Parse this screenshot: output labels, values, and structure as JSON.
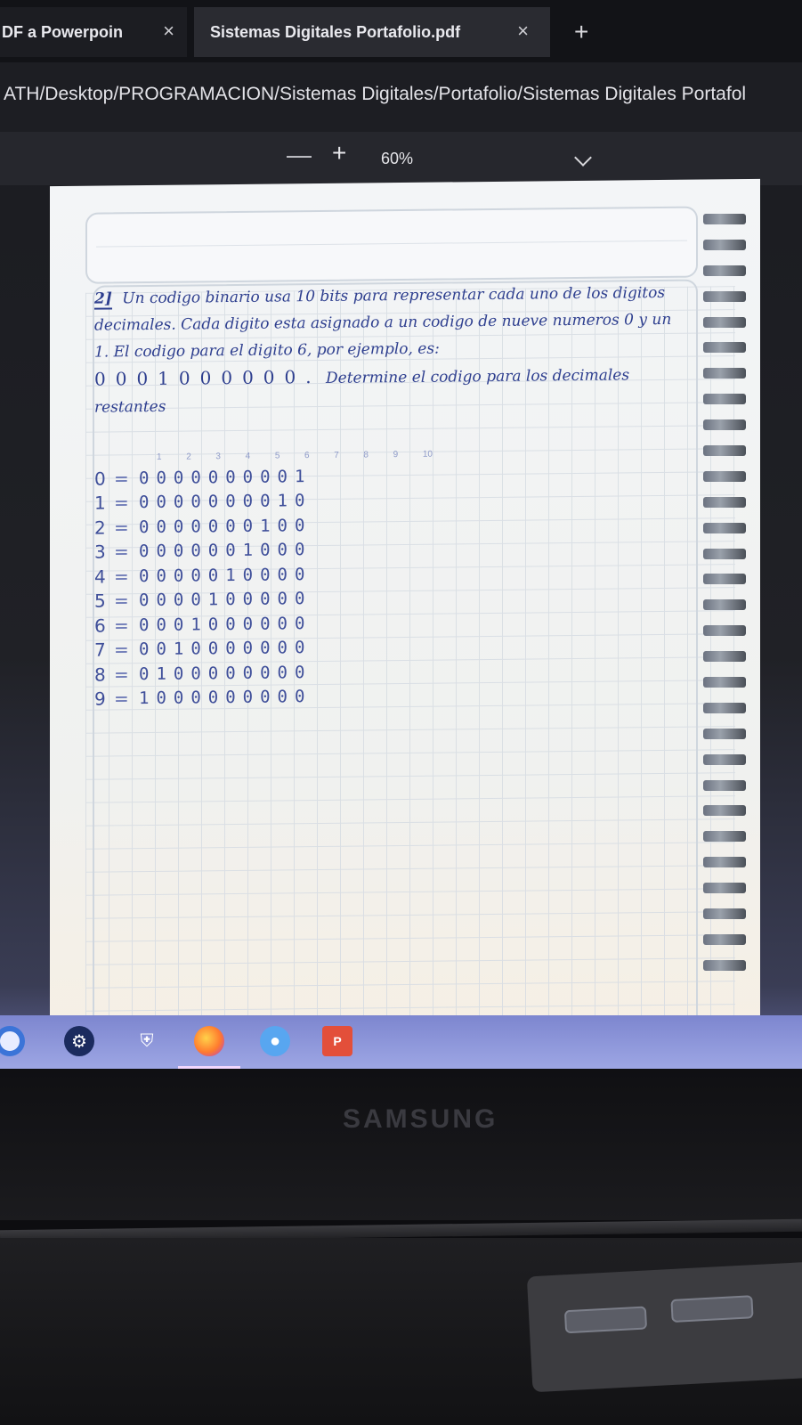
{
  "browser": {
    "tabs": [
      {
        "label": "DF a Powerpoin",
        "active": false
      },
      {
        "label": "Sistemas Digitales Portafolio.pdf",
        "active": true
      }
    ],
    "new_tab": "+",
    "close_glyph": "×",
    "url": "ATH/Desktop/PROGRAMACION/Sistemas Digitales/Portafolio/Sistemas Digitales Portafol"
  },
  "pdf_toolbar": {
    "zoom_out": "—",
    "zoom_in": "+",
    "zoom_level": "60%"
  },
  "notebook": {
    "problem_number": "2]",
    "problem_text": "Un codigo binario usa 10 bits para representar cada uno de los digitos decimales. Cada digito esta asignado a un codigo de nueve numeros 0 y un 1. El codigo para el digito 6, por ejemplo, es:",
    "example_code": "0001000000.",
    "problem_text_end": "Determine el codigo para los decimales restantes",
    "column_index": [
      "1",
      "2",
      "3",
      "4",
      "5",
      "6",
      "7",
      "8",
      "9",
      "10"
    ],
    "codes": [
      {
        "digit": "0",
        "eq": "=",
        "bits": "0000000001"
      },
      {
        "digit": "1",
        "eq": "=",
        "bits": "0000000010"
      },
      {
        "digit": "2",
        "eq": "=",
        "bits": "0000000100"
      },
      {
        "digit": "3",
        "eq": "=",
        "bits": "0000001000"
      },
      {
        "digit": "4",
        "eq": "=",
        "bits": "0000010000"
      },
      {
        "digit": "5",
        "eq": "=",
        "bits": "0000100000"
      },
      {
        "digit": "6",
        "eq": "=",
        "bits": "0001000000"
      },
      {
        "digit": "7",
        "eq": "=",
        "bits": "0010000000"
      },
      {
        "digit": "8",
        "eq": "=",
        "bits": "0100000000"
      },
      {
        "digit": "9",
        "eq": "=",
        "bits": "1000000000"
      }
    ]
  },
  "taskbar": {
    "icons": [
      "cortana-icon",
      "steam-icon",
      "security-shield-icon",
      "firefox-icon",
      "chat-icon",
      "powerpoint-icon"
    ],
    "ppt_label": "P"
  },
  "monitor": {
    "brand": "SAMSUNG"
  },
  "colors": {
    "ink": "#2e3f8f",
    "grid": "#d6dce3",
    "taskbar": "#8f98dc"
  }
}
